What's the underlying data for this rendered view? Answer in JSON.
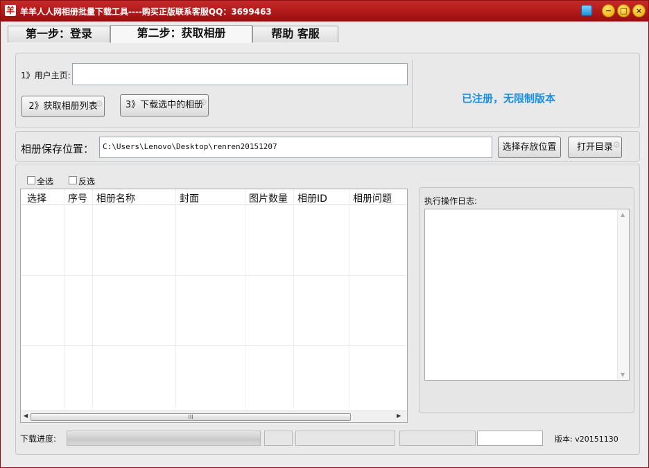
{
  "window": {
    "title": "羊羊人人网相册批量下载工具----购买正版联系客服QQ：3699463",
    "app_icon_glyph": "羊"
  },
  "tabs": [
    {
      "label": "第一步：登录"
    },
    {
      "label": "第二步：获取相册"
    },
    {
      "label": "帮助 客服"
    }
  ],
  "step": {
    "user_home_label": "1》用户主页:",
    "user_home_value": "",
    "get_album_list_label": "2》获取相册列表",
    "download_selected_label": "3》下载选中的相册",
    "registered_text": "已注册，无限制版本"
  },
  "save": {
    "label": "相册保存位置：",
    "path": "C:\\Users\\Lenovo\\Desktop\\renren20151207",
    "choose_button": "选择存放位置",
    "open_button": "打开目录"
  },
  "selection": {
    "select_all": "全选",
    "invert": "反选"
  },
  "table": {
    "columns": [
      "选择",
      "序号",
      "相册名称",
      "封面",
      "图片数量",
      "相册ID",
      "相册问题"
    ],
    "rows": [],
    "scroll_thumb_glyph": "III"
  },
  "log": {
    "label": "执行操作日志:",
    "content": ""
  },
  "footer": {
    "progress_label": "下载进度:",
    "version_label": "版本: v20151130"
  }
}
